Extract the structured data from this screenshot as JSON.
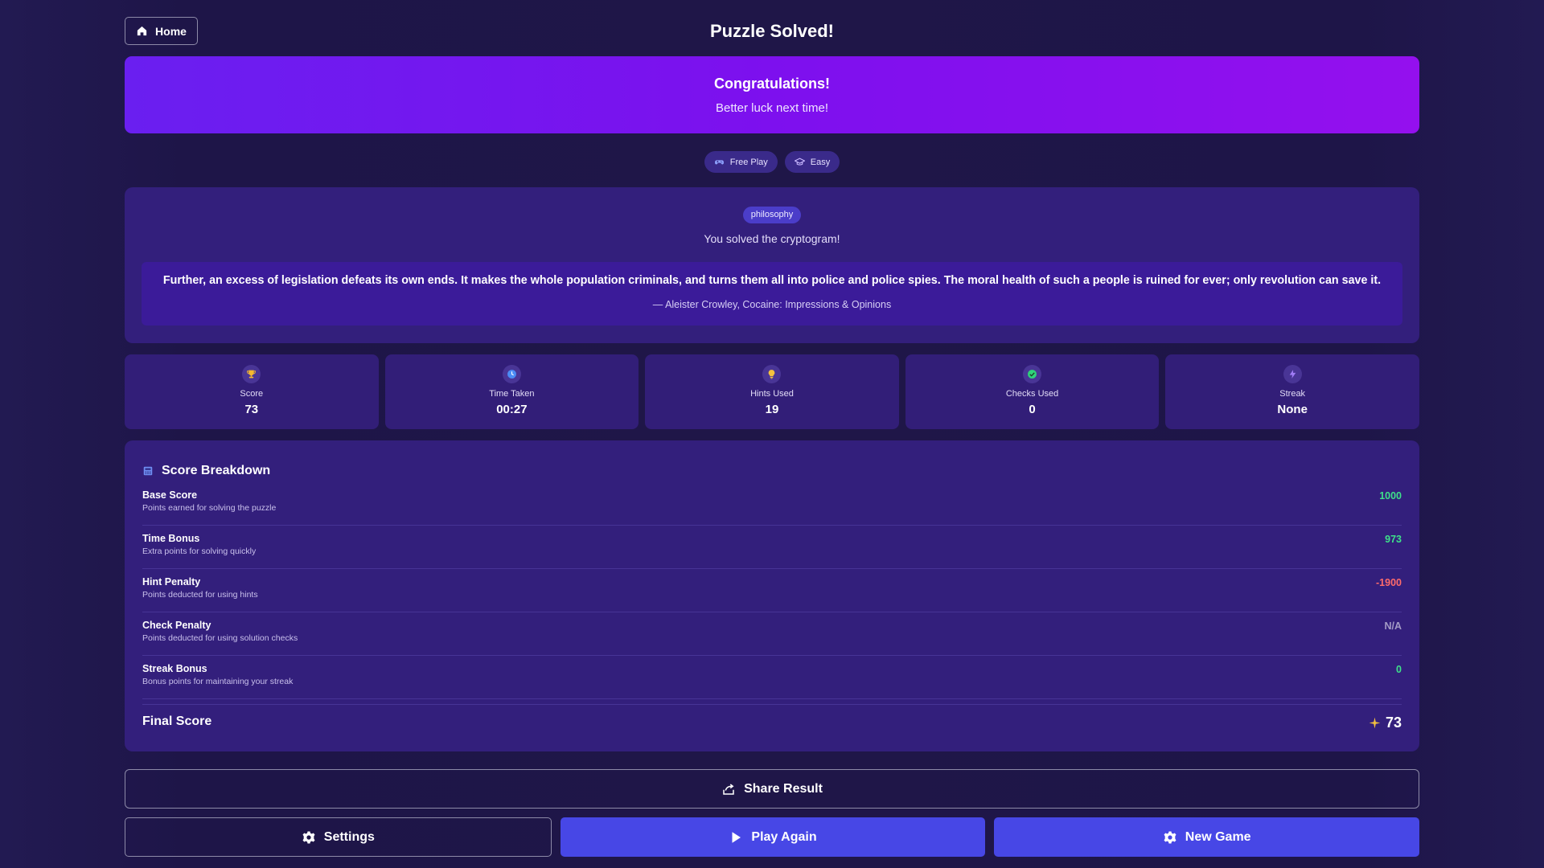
{
  "header": {
    "home_label": "Home",
    "title": "Puzzle Solved!"
  },
  "banner": {
    "heading": "Congratulations!",
    "subtext": "Better luck next time!"
  },
  "chips": {
    "mode": "Free Play",
    "difficulty": "Easy"
  },
  "puzzle": {
    "category": "philosophy",
    "status": "You solved the cryptogram!",
    "quote": "Further, an excess of legislation defeats its own ends. It makes the whole population criminals, and turns them all into police and police spies. The moral health of such a people is ruined for ever; only revolution can save it.",
    "attribution": "— Aleister Crowley, Cocaine: Impressions & Opinions"
  },
  "stats": {
    "score": {
      "label": "Score",
      "value": "73",
      "icon": "trophy-icon",
      "color": "#f5b82e"
    },
    "time": {
      "label": "Time Taken",
      "value": "00:27",
      "icon": "clock-icon",
      "color": "#4b8cf5"
    },
    "hints": {
      "label": "Hints Used",
      "value": "19",
      "icon": "lightbulb-icon",
      "color": "#f5c23e"
    },
    "checks": {
      "label": "Checks Used",
      "value": "0",
      "icon": "check-circle-icon",
      "color": "#2fd27a"
    },
    "streak": {
      "label": "Streak",
      "value": "None",
      "icon": "lightning-icon",
      "color": "#a07cf5"
    }
  },
  "breakdown": {
    "title": "Score Breakdown",
    "rows": [
      {
        "name": "Base Score",
        "desc": "Points earned for solving the puzzle",
        "amount": "1000",
        "tone": "green"
      },
      {
        "name": "Time Bonus",
        "desc": "Extra points for solving quickly",
        "amount": "973",
        "tone": "green"
      },
      {
        "name": "Hint Penalty",
        "desc": "Points deducted for using hints",
        "amount": "-1900",
        "tone": "red"
      },
      {
        "name": "Check Penalty",
        "desc": "Points deducted for using solution checks",
        "amount": "N/A",
        "tone": "grey"
      },
      {
        "name": "Streak Bonus",
        "desc": "Bonus points for maintaining your streak",
        "amount": "0",
        "tone": "green"
      }
    ],
    "final_label": "Final Score",
    "final_value": "73"
  },
  "actions": {
    "share": "Share Result",
    "settings": "Settings",
    "play_again": "Play Again",
    "new_game": "New Game"
  },
  "colors": {
    "accent": "#4747e6",
    "banner_start": "#6a1ff0",
    "banner_end": "#9410ee",
    "positive": "#3ee08a",
    "negative": "#ff6b6b"
  }
}
